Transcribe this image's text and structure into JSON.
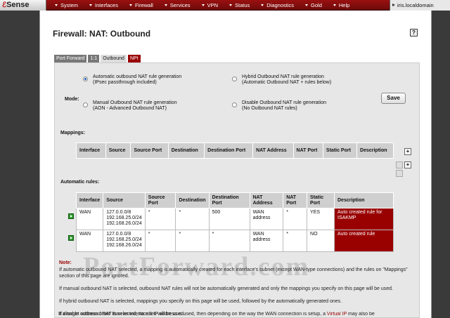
{
  "app": {
    "logo": "Sense",
    "hostname": "iris.localdomain"
  },
  "menu": [
    "System",
    "Interfaces",
    "Firewall",
    "Services",
    "VPN",
    "Status",
    "Diagnostics",
    "Gold",
    "Help"
  ],
  "page": {
    "title": "Firewall: NAT: Outbound",
    "help_icon": "?",
    "tabs": [
      "Port Forward",
      "1:1",
      "Outbound",
      "NPt"
    ]
  },
  "mode": {
    "label": "Mode:",
    "options": [
      {
        "line1": "Automatic outbound NAT rule generation",
        "line2": "(IPsec passthrough included)",
        "selected": true
      },
      {
        "line1": "Hybrid Outbound NAT rule generation",
        "line2": "(Automatic Outbound NAT + rules below)",
        "selected": false
      },
      {
        "line1": "Manual Outbound NAT rule generation",
        "line2": "(AON - Advanced Outbound NAT)",
        "selected": false
      },
      {
        "line1": "Disable Outbound NAT rule generation",
        "line2": "(No Outbound NAT rules)",
        "selected": false
      }
    ],
    "save_label": "Save"
  },
  "mappings": {
    "label": "Mappings:",
    "columns": [
      "Interface",
      "Source",
      "Source Port",
      "Destination",
      "Destination Port",
      "NAT Address",
      "NAT Port",
      "Static Port",
      "Description"
    ]
  },
  "auto_rules": {
    "label": "Automatic rules:",
    "rows": [
      {
        "interface": "WAN",
        "source": [
          "127.0.0.0/8",
          "192.168.25.0/24",
          "192.168.26.0/24"
        ],
        "source_port": "*",
        "destination": "*",
        "destination_port": "500",
        "nat_address": "WAN address",
        "nat_port": "*",
        "static_port": "YES",
        "description": "Auto created rule for ISAKMP"
      },
      {
        "interface": "WAN",
        "source": [
          "127.0.0.0/8",
          "192.168.25.0/24",
          "192.168.26.0/24"
        ],
        "source_port": "*",
        "destination": "*",
        "destination_port": "*",
        "nat_address": "WAN address",
        "nat_port": "*",
        "static_port": "NO",
        "description": "Auto created rule"
      }
    ]
  },
  "note": {
    "title": "Note:",
    "p1": "If automatic outbound NAT selected, a mapping is automatically created for each interface's subnet (except WAN-type connections) and the rules on \"Mappings\" section of this page are ignored.",
    "p2": "If manual outbound NAT is selected, outbound NAT rules will not be automatically generated and only the mappings you specify on this page will be used.",
    "p3": "If hybrid outbound NAT is selected, mappings you specify on this page will be used, followed by the automatically generated ones.",
    "p4": "If disable outbound NAT is selected, no rules will be used.",
    "p5a": "If a target address other than an interface's IP address is used, then depending on the way the WAN connection is setup, a ",
    "p5_link": "Virtual IP",
    "p5b": " may also be"
  },
  "watermark": "PortForward.com",
  "colors": {
    "nav_red": "#8b0d0d",
    "accent_red": "#990000",
    "tab_gray": "#777777"
  }
}
